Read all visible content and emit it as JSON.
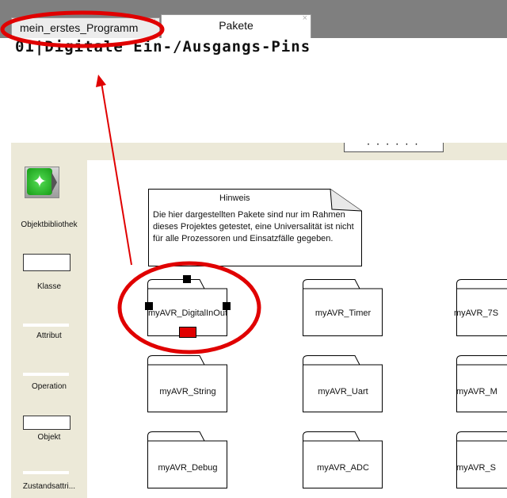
{
  "tabs": [
    {
      "label": "mein_erstes_Programm"
    },
    {
      "label": "Pakete"
    }
  ],
  "tab_close_glyph": "×",
  "editor": {
    "code_line": "01|Digitale Ein-/Ausgangs-Pins"
  },
  "splitter": {
    "grip_dots": "· · · · · ·"
  },
  "toolbox": {
    "items": [
      {
        "label": "Objektbibliothek",
        "icon": "running-man-icon"
      },
      {
        "label": "Klasse",
        "icon": "class-box-icon"
      },
      {
        "label": "Attribut",
        "icon": "attribute-line-icon"
      },
      {
        "label": "Operation",
        "icon": "operation-line-icon"
      },
      {
        "label": "Objekt",
        "icon": "object-box-icon"
      },
      {
        "label": "Zustandsattri...",
        "icon": "state-attribute-icon"
      }
    ]
  },
  "note": {
    "title": "Hinweis",
    "body": "Die hier dargestellten Pakete sind nur im Rahmen dieses Projektes getestet, eine Universalität ist nicht für alle Prozessoren und Einsatzfälle gegeben."
  },
  "packages": [
    {
      "label": "myAVR_DigitalInOut",
      "selected": true
    },
    {
      "label": "myAVR_Timer"
    },
    {
      "label": "myAVR_7S"
    },
    {
      "label": "myAVR_String"
    },
    {
      "label": "myAVR_Uart"
    },
    {
      "label": "myAVR_M"
    },
    {
      "label": "myAVR_Debug"
    },
    {
      "label": "myAVR_ADC"
    },
    {
      "label": "myAVR_S"
    }
  ],
  "annotation_color": "#e00000"
}
